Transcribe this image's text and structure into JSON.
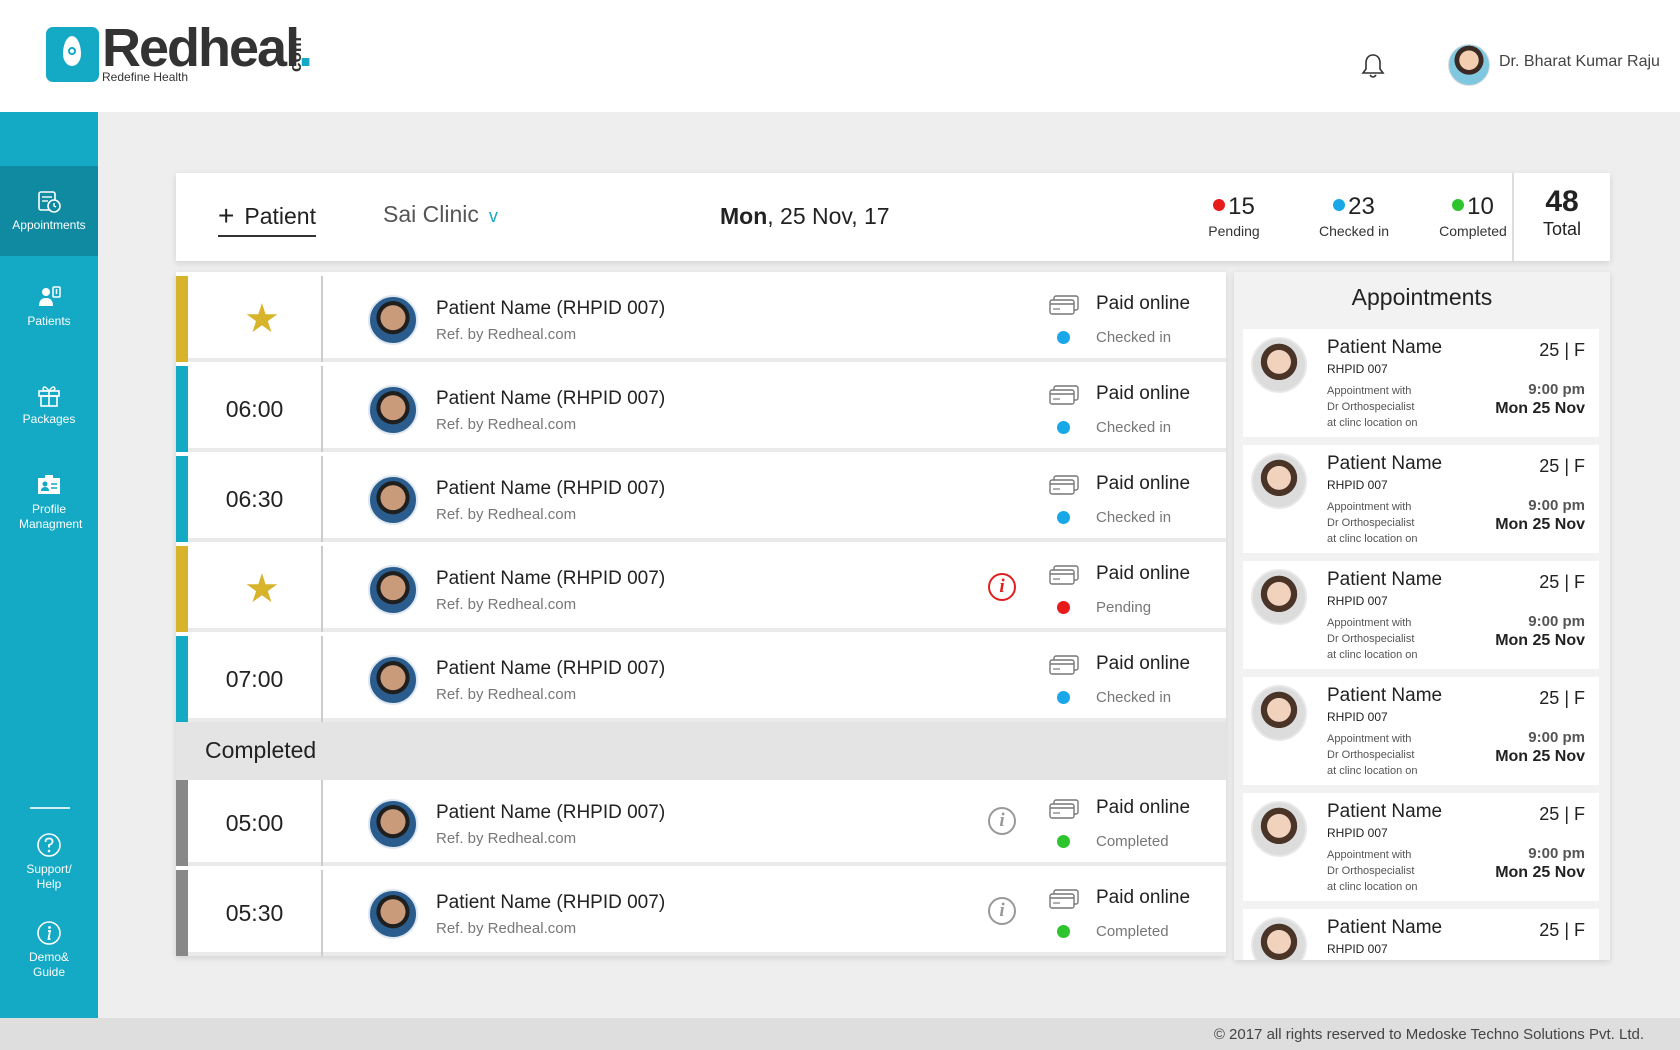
{
  "header": {
    "logo_text": "Redheal",
    "logo_suffix": "com",
    "logo_tagline": "Redefine Health",
    "user_name": "Dr. Bharat Kumar Raju"
  },
  "sidebar": {
    "items": [
      {
        "label": "Appointments",
        "icon": "calendar-clock-icon",
        "active": true
      },
      {
        "label": "Patients",
        "icon": "patients-icon",
        "active": false
      },
      {
        "label": "Packages",
        "icon": "gift-icon",
        "active": false
      },
      {
        "label": "Profile Managment",
        "icon": "profile-card-icon",
        "active": false
      },
      {
        "label": "Support/ Help",
        "icon": "help-icon",
        "active": false
      },
      {
        "label": "Demo& Guide",
        "icon": "info-icon",
        "active": false
      }
    ]
  },
  "topbar": {
    "add_patient_label": "Patient",
    "clinic": "Sai Clinic",
    "date_day": "Mon",
    "date_rest": ", 25 Nov, 17",
    "stats": [
      {
        "count": "15",
        "label": "Pending",
        "color": "#e81b1b"
      },
      {
        "count": "23",
        "label": "Checked in",
        "color": "#18a8e8"
      },
      {
        "count": "10",
        "label": "Completed",
        "color": "#2ec42e"
      }
    ],
    "total_count": "48",
    "total_label": "Total"
  },
  "colors": {
    "accent": "#14a9c4",
    "starred_bar": "#d7b42b",
    "active_bar": "#14a9c4",
    "completed_bar": "#888888",
    "pending_dot": "#e81b1b",
    "checked_dot": "#18a8e8",
    "completed_dot": "#2ec42e"
  },
  "appointments_list": {
    "upcoming": [
      {
        "time": "",
        "starred": true,
        "name": "Patient Name (RHPID 007)",
        "ref": "Ref. by Redheal.com",
        "payment": "Paid online",
        "status": "Checked in",
        "alert": false
      },
      {
        "time": "06:00",
        "starred": false,
        "name": "Patient Name (RHPID 007)",
        "ref": "Ref. by Redheal.com",
        "payment": "Paid online",
        "status": "Checked in",
        "alert": false
      },
      {
        "time": "06:30",
        "starred": false,
        "name": "Patient Name (RHPID 007)",
        "ref": "Ref. by Redheal.com",
        "payment": "Paid online",
        "status": "Checked in",
        "alert": false
      },
      {
        "time": "",
        "starred": true,
        "name": "Patient Name (RHPID 007)",
        "ref": "Ref. by Redheal.com",
        "payment": "Paid online",
        "status": "Pending",
        "alert": true
      },
      {
        "time": "07:00",
        "starred": false,
        "name": "Patient Name (RHPID 007)",
        "ref": "Ref. by Redheal.com",
        "payment": "Paid online",
        "status": "Checked in",
        "alert": false
      }
    ],
    "completed_heading": "Completed",
    "completed": [
      {
        "time": "05:00",
        "name": "Patient Name (RHPID 007)",
        "ref": "Ref. by Redheal.com",
        "payment": "Paid online",
        "status": "Completed"
      },
      {
        "time": "05:30",
        "name": "Patient Name (RHPID 007)",
        "ref": "Ref. by Redheal.com",
        "payment": "Paid online",
        "status": "Completed"
      }
    ]
  },
  "appointments_panel": {
    "title": "Appointments",
    "cards": [
      {
        "name": "Patient Name",
        "id": "RHPID 007",
        "age_sex": "25 | F",
        "note1": "Appointment with",
        "note2": "Dr Orthospecialist",
        "note3": "at clinc location on",
        "time": "9:00 pm",
        "date": "Mon 25 Nov"
      },
      {
        "name": "Patient Name",
        "id": "RHPID 007",
        "age_sex": "25 | F",
        "note1": "Appointment with",
        "note2": "Dr Orthospecialist",
        "note3": "at clinc location on",
        "time": "9:00 pm",
        "date": "Mon 25 Nov"
      },
      {
        "name": "Patient Name",
        "id": "RHPID 007",
        "age_sex": "25 | F",
        "note1": "Appointment with",
        "note2": "Dr Orthospecialist",
        "note3": "at clinc location on",
        "time": "9:00 pm",
        "date": "Mon 25 Nov"
      },
      {
        "name": "Patient Name",
        "id": "RHPID 007",
        "age_sex": "25 | F",
        "note1": "Appointment with",
        "note2": "Dr Orthospecialist",
        "note3": "at clinc location on",
        "time": "9:00 pm",
        "date": "Mon 25 Nov"
      },
      {
        "name": "Patient Name",
        "id": "RHPID 007",
        "age_sex": "25 | F",
        "note1": "Appointment with",
        "note2": "Dr Orthospecialist",
        "note3": "at clinc location on",
        "time": "9:00 pm",
        "date": "Mon 25 Nov"
      },
      {
        "name": "Patient Name",
        "id": "RHPID 007",
        "age_sex": "25 | F",
        "note1": "",
        "note2": "",
        "note3": "",
        "time": "",
        "date": ""
      }
    ]
  },
  "footer": {
    "copyright": "© 2017 all rights reserved to Medoske Techno Solutions Pvt. Ltd."
  }
}
